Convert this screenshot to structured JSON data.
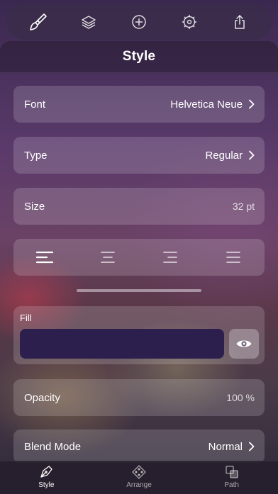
{
  "toolbar": {
    "icons": [
      "brush-icon",
      "layers-icon",
      "add-icon",
      "settings-gear-icon",
      "share-icon"
    ]
  },
  "panel": {
    "title": "Style"
  },
  "rows": {
    "font": {
      "label": "Font",
      "value": "Helvetica Neue"
    },
    "type": {
      "label": "Type",
      "value": "Regular"
    },
    "size": {
      "label": "Size",
      "value": "32 pt"
    },
    "opacity": {
      "label": "Opacity",
      "value": "100 %"
    },
    "blend": {
      "label": "Blend Mode",
      "value": "Normal"
    }
  },
  "alignment": {
    "options": [
      "align-left-icon",
      "align-center-icon",
      "align-right-icon",
      "align-justify-icon"
    ],
    "selected": "align-left-icon"
  },
  "fill": {
    "label": "Fill",
    "color": "#2c1f4e",
    "visible": true
  },
  "tabs": [
    {
      "label": "Style",
      "active": true
    },
    {
      "label": "Arrange",
      "active": false
    },
    {
      "label": "Path",
      "active": false
    }
  ]
}
